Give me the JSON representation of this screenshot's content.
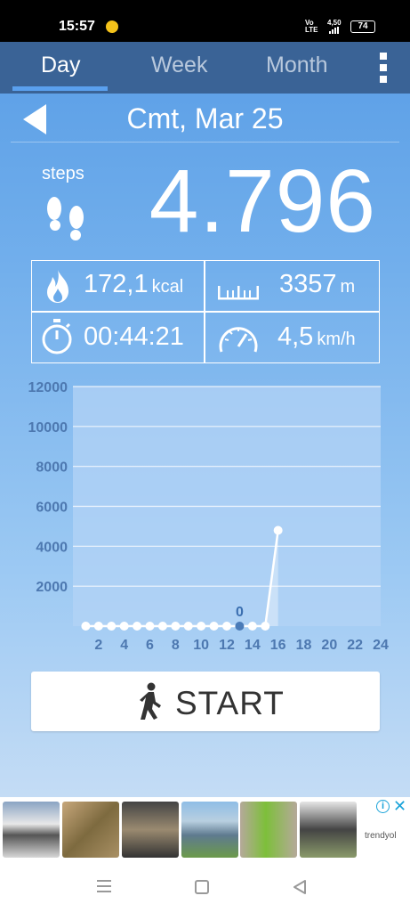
{
  "status_bar": {
    "time": "15:57",
    "volte": "Vo\nLTE",
    "network": "4,50",
    "battery": "74"
  },
  "tabs": [
    {
      "label": "Day",
      "active": true
    },
    {
      "label": "Week",
      "active": false
    },
    {
      "label": "Month",
      "active": false
    }
  ],
  "date": {
    "title": "Cmt, Mar 25"
  },
  "steps": {
    "label": "steps",
    "value": "4.796"
  },
  "stats": {
    "calories": {
      "value": "172,1",
      "unit": "kcal"
    },
    "distance": {
      "value": "3357",
      "unit": "m"
    },
    "duration": {
      "value": "00:44:21",
      "unit": ""
    },
    "speed": {
      "value": "4,5",
      "unit": "km/h"
    }
  },
  "chart_data": {
    "type": "line",
    "y_ticks": [
      "12000",
      "10000",
      "8000",
      "6000",
      "4000",
      "2000"
    ],
    "x_ticks": [
      "2",
      "4",
      "6",
      "8",
      "10",
      "12",
      "14",
      "16",
      "18",
      "20",
      "22",
      "24"
    ],
    "ylim": [
      0,
      12000
    ],
    "x": [
      1,
      2,
      3,
      4,
      5,
      6,
      7,
      8,
      9,
      10,
      11,
      12,
      13,
      14,
      15,
      16
    ],
    "values": [
      0,
      0,
      0,
      0,
      0,
      0,
      0,
      0,
      0,
      0,
      0,
      0,
      0,
      0,
      0,
      4796
    ],
    "highlight": {
      "x": 13,
      "label": "0"
    },
    "colors": {
      "plot_bg": "#b3d3f5",
      "line": "#ffffff",
      "marker": "#ffffff",
      "highlight_marker": "#4a7bb8",
      "highlight_label": "#3b6fb0",
      "tick_label": "#4d78b0"
    }
  },
  "start_button": {
    "label": "START"
  },
  "ad": {
    "brand": "trendyol",
    "info": "i",
    "close": "✕"
  },
  "colors": {
    "tabbar": "#3a6396",
    "accent": "#5aa0ee"
  }
}
